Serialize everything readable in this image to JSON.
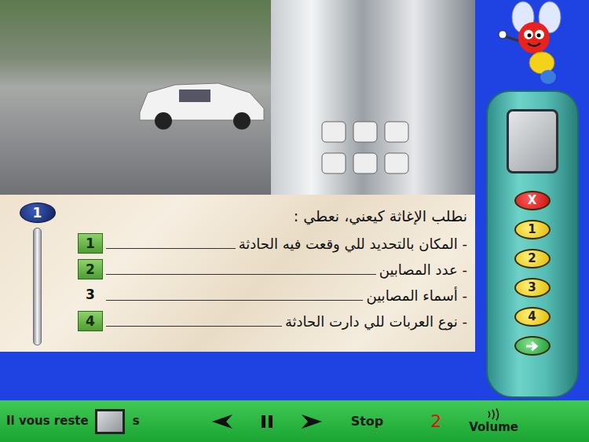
{
  "question": {
    "number": "1",
    "prompt": "نطلب الإغاثة كيعني، نعطي :"
  },
  "options": [
    {
      "text": "- المكان بالتحديد للي وقعت فيه الحادثة",
      "number": "1",
      "selected": true
    },
    {
      "text": "- عدد المصابين",
      "number": "2",
      "selected": true
    },
    {
      "text": "- أسماء المصابين",
      "number": "3",
      "selected": false
    },
    {
      "text": "- نوع العربات للي دارت الحادثة",
      "number": "4",
      "selected": true
    }
  ],
  "keypad": [
    {
      "label": "X",
      "kind": "cancel"
    },
    {
      "label": "1",
      "kind": "answer"
    },
    {
      "label": "2",
      "kind": "answer"
    },
    {
      "label": "3",
      "kind": "answer"
    },
    {
      "label": "4",
      "kind": "answer"
    },
    {
      "label": "",
      "kind": "validate"
    }
  ],
  "footer": {
    "timer_label": "Il vous reste",
    "timer_unit": "s",
    "stop": "Stop",
    "page": "2",
    "volume": "Volume"
  }
}
